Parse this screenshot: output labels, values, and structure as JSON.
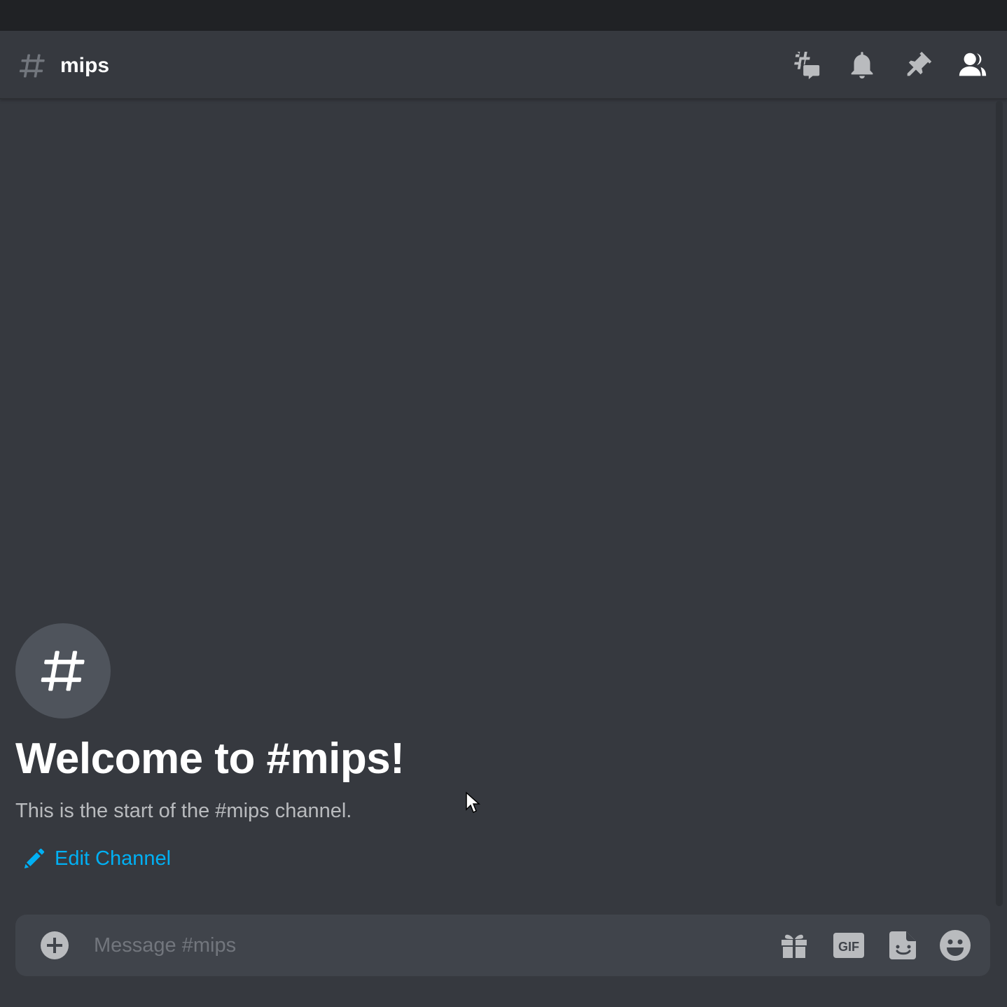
{
  "channel": {
    "name": "mips"
  },
  "header": {
    "icons": [
      "threads-icon",
      "notification-bell-icon",
      "pin-icon",
      "member-list-icon"
    ]
  },
  "welcome": {
    "title": "Welcome to #mips!",
    "subtitle": "This is the start of the #mips channel.",
    "edit_label": "Edit Channel"
  },
  "composer": {
    "placeholder": "Message #mips",
    "value": "",
    "gif_label": "GIF",
    "icons": [
      "add-attachment-icon",
      "gift-icon",
      "gif-icon",
      "sticker-icon",
      "emoji-icon"
    ]
  },
  "colors": {
    "background": "#36393f",
    "titlebar": "#202225",
    "composer": "#40444b",
    "link": "#00b0f4",
    "icon": "#b9bbbe",
    "muted_text": "#72767d"
  }
}
